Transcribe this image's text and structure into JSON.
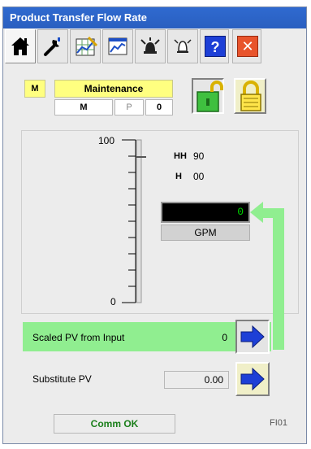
{
  "window": {
    "title": "Product Transfer Flow Rate"
  },
  "toolbar": {
    "buttons": [
      {
        "icon": "home-icon"
      },
      {
        "icon": "wrench-icon"
      },
      {
        "icon": "edit-chart-icon"
      },
      {
        "icon": "trend-icon"
      },
      {
        "icon": "alarm-ack-icon"
      },
      {
        "icon": "alarm-bell-icon"
      },
      {
        "icon": "help-icon",
        "label": "?"
      },
      {
        "icon": "close-icon",
        "label": "✕"
      }
    ]
  },
  "mode": {
    "indicator": "M",
    "name": "Maintenance",
    "cells": [
      "M",
      "P",
      "0"
    ],
    "lock_icons": [
      "unlock-icon",
      "lock-icon"
    ]
  },
  "scale": {
    "max": "100",
    "min": "0"
  },
  "limits": [
    {
      "symbol": "HH",
      "value": "90"
    },
    {
      "symbol": "H",
      "value": "00"
    }
  ],
  "pv": {
    "value": "0",
    "units": "GPM"
  },
  "scaled_pv": {
    "label": "Scaled PV from Input",
    "value": "0"
  },
  "substitute_pv": {
    "label": "Substitute PV",
    "value": "0.00"
  },
  "status": {
    "text": "Comm OK",
    "tag": "FI01"
  },
  "colors": {
    "title_bar": "#2a5fc0",
    "mode_yellow": "#ffff80",
    "selected_green": "#90ee90",
    "pv_text": "#00d000"
  }
}
